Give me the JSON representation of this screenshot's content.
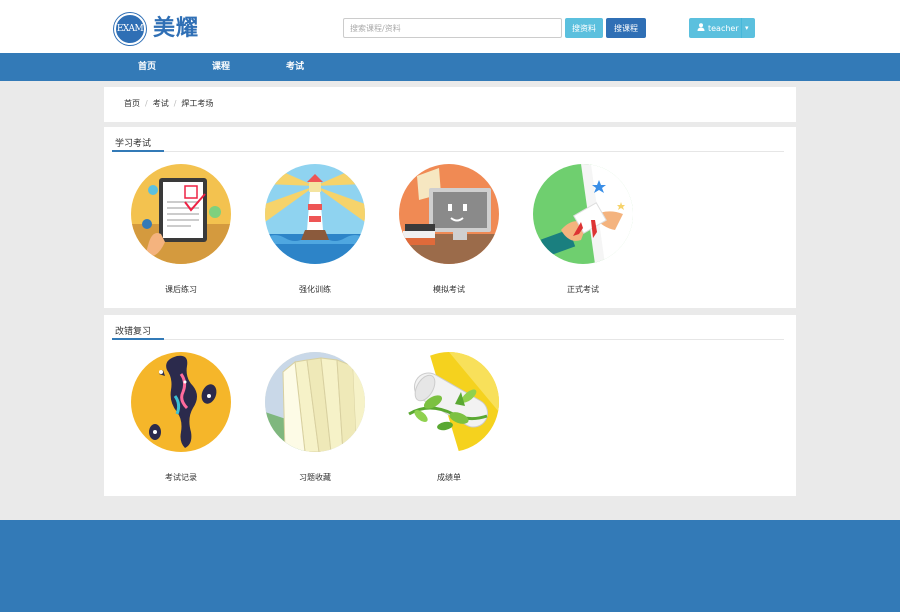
{
  "header": {
    "logo_mark": "EXAM",
    "logo_text": "美耀",
    "search_placeholder": "搜索课程/资料",
    "btn_search_resource": "搜资料",
    "btn_search_course": "搜课程",
    "user_name": "teacher"
  },
  "nav": {
    "items": [
      {
        "label": "首页"
      },
      {
        "label": "课程"
      },
      {
        "label": "考试"
      }
    ]
  },
  "breadcrumb": [
    "首页",
    "考试",
    "焊工考场"
  ],
  "sections": [
    {
      "title": "学习考试",
      "tiles": [
        {
          "label": "课后练习",
          "icon": "tablet-quiz-icon"
        },
        {
          "label": "强化训练",
          "icon": "lighthouse-icon"
        },
        {
          "label": "模拟考试",
          "icon": "monitor-books-icon"
        },
        {
          "label": "正式考试",
          "icon": "diploma-scroll-icon"
        }
      ]
    },
    {
      "title": "改错复习",
      "tiles": [
        {
          "label": "考试记录",
          "icon": "splatter-record-icon"
        },
        {
          "label": "习题收藏",
          "icon": "book-pages-icon"
        },
        {
          "label": "成绩单",
          "icon": "rolled-certificate-icon"
        }
      ]
    }
  ],
  "colors": {
    "brand": "#337ab7",
    "info": "#5bc0de",
    "background": "#eaeaea"
  }
}
